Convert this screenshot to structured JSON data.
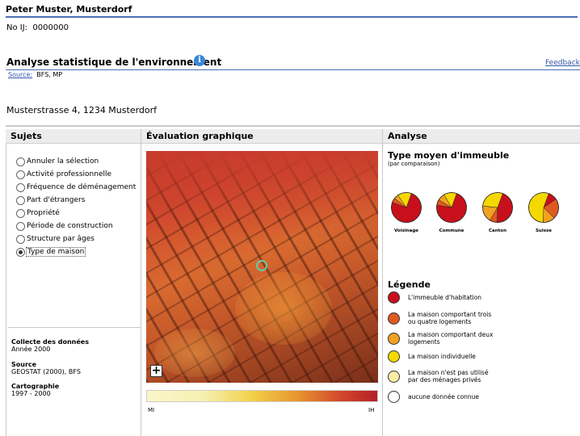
{
  "header": {
    "name": "Peter Muster, Musterdorf",
    "ij_label": "No IJ:",
    "ij_value": "0000000",
    "title": "Analyse statistique de l'environnement",
    "info_icon": "info-icon",
    "feedback": "Feedback",
    "source_label": "Source:",
    "source_value": "BFS, MP",
    "address": "Musterstrasse 4, 1234 Musterdorf"
  },
  "columns": {
    "sujets": "Sujets",
    "evaluation": "Évaluation graphique",
    "analyse": "Analyse"
  },
  "sujets": [
    {
      "label": "Annuler la sélection",
      "selected": false
    },
    {
      "label": "Activité professionnelle",
      "selected": false
    },
    {
      "label": "Fréquence de déménagement",
      "selected": false
    },
    {
      "label": "Part d'étrangers",
      "selected": false
    },
    {
      "label": "Propriété",
      "selected": false
    },
    {
      "label": "Période de construction",
      "selected": false
    },
    {
      "label": "Structure par âges",
      "selected": false
    },
    {
      "label": "Type de maison",
      "selected": true
    }
  ],
  "meta": {
    "collecte_label": "Collecte des données",
    "collecte_value": "Année 2000",
    "source_label": "Source",
    "source_value": "GEOSTAT (2000), BFS",
    "carto_label": "Cartographie",
    "carto_value": "1997 - 2000"
  },
  "map": {
    "zoom_button": "+",
    "scale_left": "MI",
    "scale_right": "IH"
  },
  "analyse": {
    "title": "Type moyen d'immeuble",
    "subtitle": "(par comparaison)",
    "legend_title": "Légende"
  },
  "pies": [
    {
      "label": "Voisinage",
      "shares": [
        0.75,
        0.05,
        0.05,
        0.15
      ]
    },
    {
      "label": "Commune",
      "shares": [
        0.72,
        0.06,
        0.08,
        0.14
      ]
    },
    {
      "label": "Canton",
      "shares": [
        0.45,
        0.08,
        0.18,
        0.29
      ]
    },
    {
      "label": "Suisse",
      "shares": [
        0.1,
        0.22,
        0.13,
        0.55
      ]
    }
  ],
  "legend": [
    {
      "label_1": "L'immeuble d'habitation",
      "label_2": "",
      "color": "#c8101c"
    },
    {
      "label_1": "La maison comportant trois",
      "label_2": "ou quatre logements",
      "color": "#e05a20"
    },
    {
      "label_1": "La maison comportant deux",
      "label_2": "logements",
      "color": "#f2a020"
    },
    {
      "label_1": "La maison individuelle",
      "label_2": "",
      "color": "#f5d800"
    },
    {
      "label_1": "La maison n'est pas utilisé",
      "label_2": "par des ménages privés",
      "color": "#f8eca8"
    },
    {
      "label_1": "aucune donnée connue",
      "label_2": "",
      "color": "#ffffff"
    }
  ]
}
